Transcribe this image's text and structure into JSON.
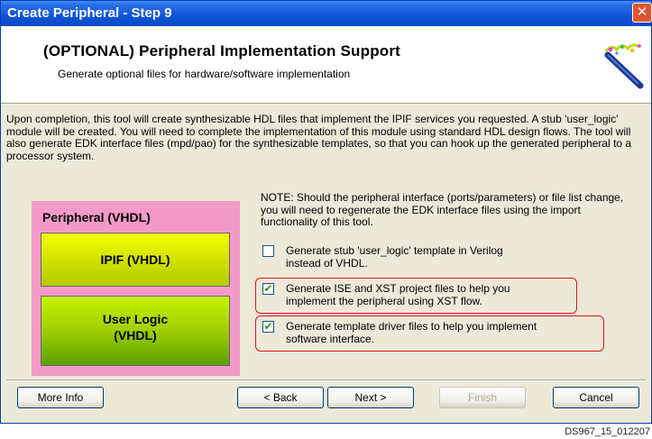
{
  "window": {
    "title": "Create Peripheral - Step 9",
    "close_glyph": "✕"
  },
  "header": {
    "title": "(OPTIONAL) Peripheral Implementation Support",
    "subtitle": "Generate optional files for hardware/software implementation",
    "icon": "magic-wand-icon"
  },
  "description": "Upon completion, this tool will create synthesizable HDL files that implement the IPIF services you requested. A stub 'user_logic' module will be created. You will need to complete the implementation of this module using standard HDL design flows. The tool will also generate EDK interface files (mpd/pao) for the synthesizable templates, so that you can hook up the generated peripheral to a processor system.",
  "diagram": {
    "title": "Peripheral (VHDL)",
    "ipif_label": "IPIF (VHDL)",
    "user_logic_line1": "User Logic",
    "user_logic_line2": "(VHDL)",
    "colors": {
      "outer": "#f49ac8",
      "ipif": "#e6f000",
      "user_logic": "#8cc400"
    }
  },
  "note": "NOTE: Should the peripheral interface (ports/parameters) or file list change, you will need to regenerate the EDK interface files using the import functionality of this tool.",
  "options": [
    {
      "label_line1": "Generate stub 'user_logic' template in Verilog",
      "label_line2": "instead of VHDL.",
      "checked": false,
      "mark": ""
    },
    {
      "label_line1": "Generate ISE and XST project files to help you",
      "label_line2": "implement the peripheral using XST flow.",
      "checked": true,
      "mark": "✔"
    },
    {
      "label_line1": "Generate template driver files to help you implement",
      "label_line2": "software interface.",
      "checked": true,
      "mark": "✔"
    }
  ],
  "buttons": {
    "more_info": "More Info",
    "back": "< Back",
    "next": "Next >",
    "finish": "Finish",
    "cancel": "Cancel"
  },
  "figure_code": "DS967_15_012207",
  "accent_colors": {
    "titlebar": "#0a49c6",
    "highlight": "#e0141e",
    "dialog_bg": "#ece9d8"
  }
}
